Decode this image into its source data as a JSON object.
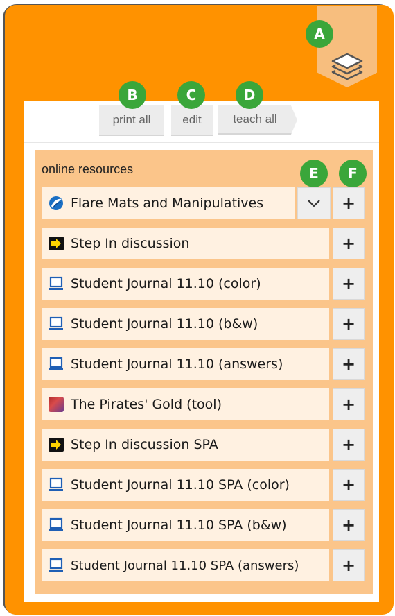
{
  "callouts": [
    "A",
    "B",
    "C",
    "D",
    "E",
    "F"
  ],
  "toolbar": {
    "print_all": "print all",
    "edit": "edit",
    "teach_all": "teach all"
  },
  "resources": {
    "title": "online resources",
    "items": [
      {
        "label": "Flare Mats and Manipulatives",
        "icon": "flare-logo-icon"
      },
      {
        "label": "Step In discussion",
        "icon": "step-in-arrow-icon"
      },
      {
        "label": "Student Journal 11.10 (color)",
        "icon": "computer-icon"
      },
      {
        "label": "Student Journal 11.10 (b&w)",
        "icon": "computer-icon"
      },
      {
        "label": "Student Journal 11.10 (answers)",
        "icon": "computer-icon"
      },
      {
        "label": "The Pirates' Gold (tool)",
        "icon": "pirate-map-icon"
      },
      {
        "label": "Step In discussion SPA",
        "icon": "step-in-arrow-icon"
      },
      {
        "label": "Student Journal 11.10 SPA (color)",
        "icon": "computer-icon"
      },
      {
        "label": "Student Journal 11.10 SPA (b&w)",
        "icon": "computer-icon"
      },
      {
        "label": "Student Journal 11.10 SPA (answers)",
        "icon": "computer-icon"
      }
    ],
    "add_symbol": "+"
  },
  "colors": {
    "panel": "#ff9200",
    "resources_bg": "#fbc58a",
    "row_bg": "#fff1e1",
    "badge": "#3aa63a"
  }
}
